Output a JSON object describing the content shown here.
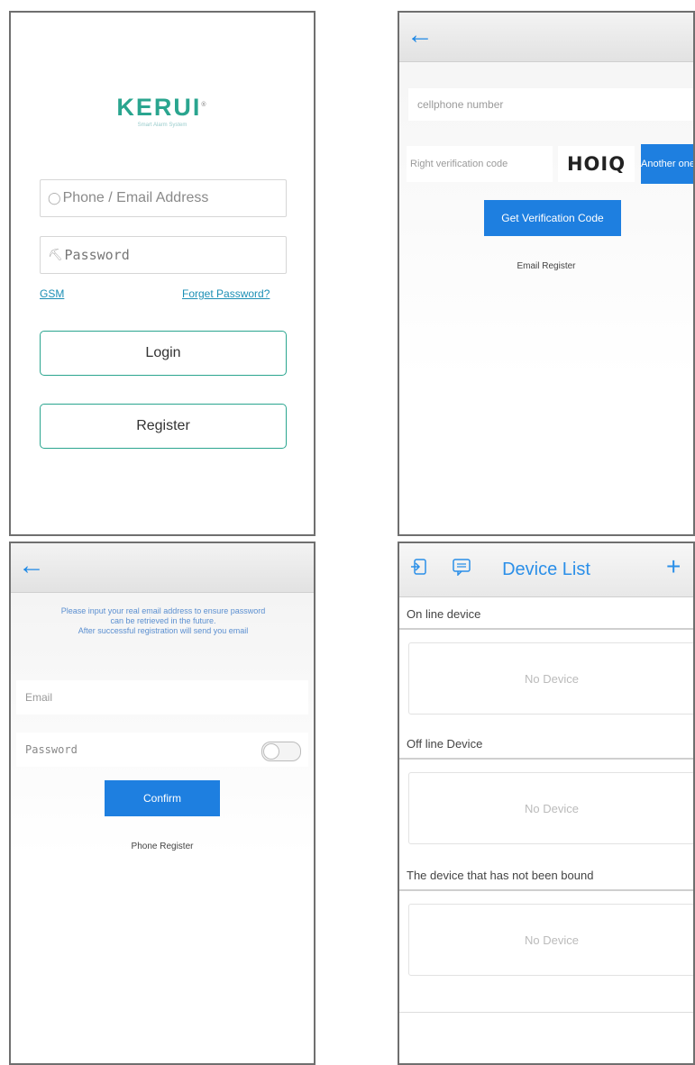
{
  "login": {
    "logo": "KERUI",
    "logo_tm": "®",
    "logo_sub": "Smart Alarm System",
    "phone_placeholder": "Phone / Email Address",
    "password_placeholder": "Password",
    "gsm_link": "GSM",
    "forget_link": "Forget Password?",
    "login_button": "Login",
    "register_button": "Register"
  },
  "phone_register": {
    "back": "←",
    "phone_placeholder": "cellphone number",
    "code_placeholder": "Right verification code",
    "captcha": "HOIQ",
    "another_button": "Another one",
    "get_code_button": "Get Verification Code",
    "email_register_link": "Email Register"
  },
  "email_register": {
    "back": "←",
    "notice_line1": "Please input your real email address to ensure password",
    "notice_line2": "can be retrieved in the future.",
    "notice_line3": "After successful registration will send you email",
    "email_placeholder": "Email",
    "password_placeholder": "Password",
    "confirm_button": "Confirm",
    "phone_register_link": "Phone Register"
  },
  "device_list": {
    "title": "Device List",
    "add": "+",
    "online_header": "On line device",
    "offline_header": "Off line Device",
    "unbound_header": "The device that has not been bound",
    "no_device": "No Device"
  },
  "colors": {
    "brand": "#2aa58f",
    "accent_blue": "#1e7fe0",
    "link_blue": "#1c8fb5"
  }
}
